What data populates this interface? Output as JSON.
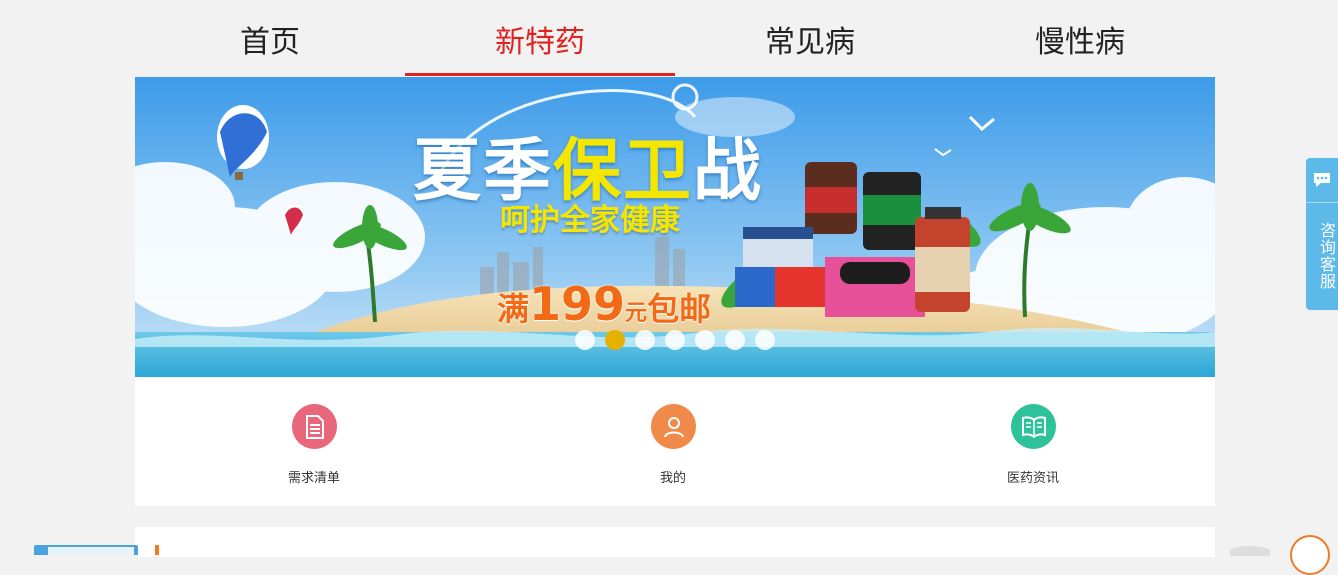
{
  "nav": {
    "tabs": [
      {
        "label": "首页"
      },
      {
        "label": "新特药",
        "active": true
      },
      {
        "label": "常见病"
      },
      {
        "label": "慢性病"
      }
    ]
  },
  "banner": {
    "title_part1": "夏季",
    "title_highlight": "保卫",
    "title_part2": "战",
    "subtitle": "呵护全家健康",
    "promo_prefix": "满",
    "promo_amount": "199",
    "promo_unit": "元",
    "promo_suffix": "包邮",
    "active_slide": 2,
    "slide_count": 7
  },
  "quick_links": [
    {
      "label": "需求清单",
      "icon": "list-document-icon",
      "color": "#e8677a"
    },
    {
      "label": "我的",
      "icon": "user-icon",
      "color": "#f08a4a"
    },
    {
      "label": "医药资讯",
      "icon": "open-book-icon",
      "color": "#2ec29a"
    }
  ],
  "side_service": {
    "label": "咨询客服",
    "icon": "chat-bubble-icon"
  },
  "colors": {
    "accent": "#e1231f",
    "promo": "#f26a16",
    "service": "#5cb9ea",
    "dot_active": "#e5b100"
  }
}
